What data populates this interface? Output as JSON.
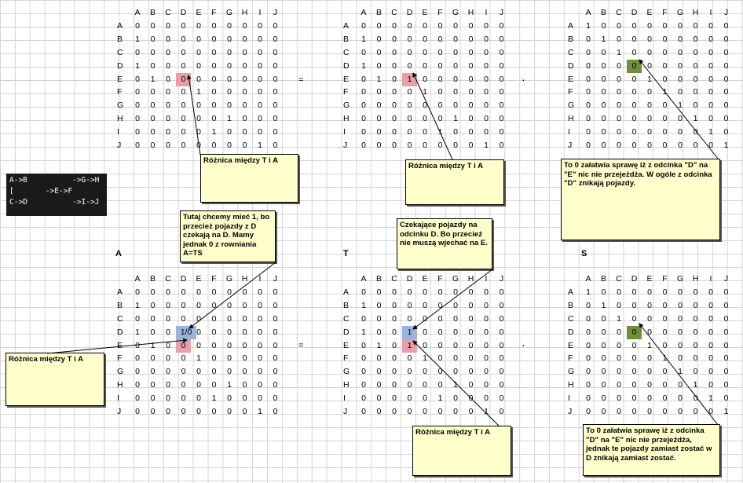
{
  "columns": [
    "A",
    "B",
    "C",
    "D",
    "E",
    "F",
    "G",
    "H",
    "I",
    "J"
  ],
  "matrices": [
    {
      "id": "m1",
      "label": "",
      "rows": [
        [
          "A",
          "0",
          "0",
          "0",
          "0",
          "0",
          "0",
          "0",
          "0",
          "0",
          "0"
        ],
        [
          "B",
          "1",
          "0",
          "0",
          "0",
          "0",
          "0",
          "0",
          "0",
          "0",
          "0"
        ],
        [
          "C",
          "0",
          "0",
          "0",
          "0",
          "0",
          "0",
          "0",
          "0",
          "0",
          "0"
        ],
        [
          "D",
          "1",
          "0",
          "0",
          "0",
          "0",
          "0",
          "0",
          "0",
          "0",
          "0"
        ],
        [
          "E",
          "0",
          "1",
          "0",
          "0",
          "0",
          "0",
          "0",
          "0",
          "0",
          "0"
        ],
        [
          "F",
          "0",
          "0",
          "0",
          "0",
          "1",
          "0",
          "0",
          "0",
          "0",
          "0"
        ],
        [
          "G",
          "0",
          "0",
          "0",
          "0",
          "0",
          "0",
          "0",
          "0",
          "0",
          "0"
        ],
        [
          "H",
          "0",
          "0",
          "0",
          "0",
          "0",
          "0",
          "1",
          "0",
          "0",
          "0"
        ],
        [
          "I",
          "0",
          "0",
          "0",
          "0",
          "0",
          "1",
          "0",
          "0",
          "0",
          "0"
        ],
        [
          "J",
          "0",
          "0",
          "0",
          "0",
          "0",
          "0",
          "0",
          "0",
          "1",
          "0"
        ]
      ],
      "highlights": [
        {
          "row": 4,
          "col": 3,
          "color": "pink"
        }
      ]
    },
    {
      "id": "m2",
      "label": "",
      "rows": [
        [
          "A",
          "0",
          "0",
          "0",
          "0",
          "0",
          "0",
          "0",
          "0",
          "0",
          "0"
        ],
        [
          "B",
          "1",
          "0",
          "0",
          "0",
          "0",
          "0",
          "0",
          "0",
          "0",
          "0"
        ],
        [
          "C",
          "0",
          "0",
          "0",
          "0",
          "0",
          "0",
          "0",
          "0",
          "0",
          "0"
        ],
        [
          "D",
          "1",
          "0",
          "0",
          "0",
          "0",
          "0",
          "0",
          "0",
          "0",
          "0"
        ],
        [
          "E",
          "0",
          "1",
          "0",
          "1",
          "0",
          "0",
          "0",
          "0",
          "0",
          "0"
        ],
        [
          "F",
          "0",
          "0",
          "0",
          "0",
          "1",
          "0",
          "0",
          "0",
          "0",
          "0"
        ],
        [
          "G",
          "0",
          "0",
          "0",
          "0",
          "0",
          "0",
          "0",
          "0",
          "0",
          "0"
        ],
        [
          "H",
          "0",
          "0",
          "0",
          "0",
          "0",
          "0",
          "1",
          "0",
          "0",
          "0"
        ],
        [
          "I",
          "0",
          "0",
          "0",
          "0",
          "0",
          "1",
          "0",
          "0",
          "0",
          "0"
        ],
        [
          "J",
          "0",
          "0",
          "0",
          "0",
          "0",
          "0",
          "0",
          "0",
          "1",
          "0"
        ]
      ],
      "highlights": [
        {
          "row": 4,
          "col": 3,
          "color": "pink"
        }
      ]
    },
    {
      "id": "m3",
      "label": "",
      "rows": [
        [
          "A",
          "1",
          "0",
          "0",
          "0",
          "0",
          "0",
          "0",
          "0",
          "0",
          "0"
        ],
        [
          "B",
          "0",
          "1",
          "0",
          "0",
          "0",
          "0",
          "0",
          "0",
          "0",
          "0"
        ],
        [
          "C",
          "0",
          "0",
          "1",
          "0",
          "0",
          "0",
          "0",
          "0",
          "0",
          "0"
        ],
        [
          "D",
          "0",
          "0",
          "0",
          "0",
          "0",
          "0",
          "0",
          "0",
          "0",
          "0"
        ],
        [
          "E",
          "0",
          "0",
          "0",
          "0",
          "1",
          "0",
          "0",
          "0",
          "0",
          "0"
        ],
        [
          "F",
          "0",
          "0",
          "0",
          "0",
          "0",
          "1",
          "0",
          "0",
          "0",
          "0"
        ],
        [
          "G",
          "0",
          "0",
          "0",
          "0",
          "0",
          "0",
          "1",
          "0",
          "0",
          "0"
        ],
        [
          "H",
          "0",
          "0",
          "0",
          "0",
          "0",
          "0",
          "0",
          "1",
          "0",
          "0"
        ],
        [
          "I",
          "0",
          "0",
          "0",
          "0",
          "0",
          "0",
          "0",
          "0",
          "1",
          "0"
        ],
        [
          "J",
          "0",
          "0",
          "0",
          "0",
          "0",
          "0",
          "0",
          "0",
          "0",
          "1"
        ]
      ],
      "highlights": [
        {
          "row": 3,
          "col": 3,
          "color": "green"
        }
      ]
    },
    {
      "id": "m4",
      "label": "A",
      "rows": [
        [
          "A",
          "0",
          "0",
          "0",
          "0",
          "0",
          "0",
          "0",
          "0",
          "0",
          "0"
        ],
        [
          "B",
          "1",
          "0",
          "0",
          "0",
          "0",
          "0",
          "0",
          "0",
          "0",
          "0"
        ],
        [
          "C",
          "0",
          "0",
          "0",
          "0",
          "0",
          "0",
          "0",
          "0",
          "0",
          "0"
        ],
        [
          "D",
          "1",
          "0",
          "0",
          "1/0",
          "0",
          "0",
          "0",
          "0",
          "0",
          "0"
        ],
        [
          "E",
          "0",
          "1",
          "0",
          "0",
          "0",
          "0",
          "0",
          "0",
          "0",
          "0"
        ],
        [
          "F",
          "0",
          "0",
          "0",
          "0",
          "1",
          "0",
          "0",
          "0",
          "0",
          "0"
        ],
        [
          "G",
          "0",
          "0",
          "0",
          "0",
          "0",
          "0",
          "0",
          "0",
          "0",
          "0"
        ],
        [
          "H",
          "0",
          "0",
          "0",
          "0",
          "0",
          "0",
          "1",
          "0",
          "0",
          "0"
        ],
        [
          "I",
          "0",
          "0",
          "0",
          "0",
          "0",
          "1",
          "0",
          "0",
          "0",
          "0"
        ],
        [
          "J",
          "0",
          "0",
          "0",
          "0",
          "0",
          "0",
          "0",
          "0",
          "1",
          "0"
        ]
      ],
      "highlights": [
        {
          "row": 3,
          "col": 3,
          "color": "blue"
        },
        {
          "row": 4,
          "col": 3,
          "color": "pink"
        }
      ]
    },
    {
      "id": "m5",
      "label": "T",
      "rows": [
        [
          "A",
          "0",
          "0",
          "0",
          "0",
          "0",
          "0",
          "0",
          "0",
          "0",
          "0"
        ],
        [
          "B",
          "1",
          "0",
          "0",
          "0",
          "0",
          "0",
          "0",
          "0",
          "0",
          "0"
        ],
        [
          "C",
          "0",
          "0",
          "0",
          "0",
          "0",
          "0",
          "0",
          "0",
          "0",
          "0"
        ],
        [
          "D",
          "1",
          "0",
          "0",
          "1",
          "0",
          "0",
          "0",
          "0",
          "0",
          "0"
        ],
        [
          "E",
          "0",
          "1",
          "0",
          "1",
          "0",
          "0",
          "0",
          "0",
          "0",
          "0"
        ],
        [
          "F",
          "0",
          "0",
          "0",
          "0",
          "1",
          "0",
          "0",
          "0",
          "0",
          "0"
        ],
        [
          "G",
          "0",
          "0",
          "0",
          "0",
          "0",
          "0",
          "0",
          "0",
          "0",
          "0"
        ],
        [
          "H",
          "0",
          "0",
          "0",
          "0",
          "0",
          "0",
          "1",
          "0",
          "0",
          "0"
        ],
        [
          "I",
          "0",
          "0",
          "0",
          "0",
          "0",
          "1",
          "0",
          "0",
          "0",
          "0"
        ],
        [
          "J",
          "0",
          "0",
          "0",
          "0",
          "0",
          "0",
          "0",
          "0",
          "1",
          "0"
        ]
      ],
      "highlights": [
        {
          "row": 3,
          "col": 3,
          "color": "blue"
        },
        {
          "row": 4,
          "col": 3,
          "color": "pink"
        }
      ]
    },
    {
      "id": "m6",
      "label": "S",
      "rows": [
        [
          "A",
          "1",
          "0",
          "0",
          "0",
          "0",
          "0",
          "0",
          "0",
          "0",
          "0"
        ],
        [
          "B",
          "0",
          "1",
          "0",
          "0",
          "0",
          "0",
          "0",
          "0",
          "0",
          "0"
        ],
        [
          "C",
          "0",
          "0",
          "1",
          "0",
          "0",
          "0",
          "0",
          "0",
          "0",
          "0"
        ],
        [
          "D",
          "0",
          "0",
          "0",
          "0",
          "0",
          "0",
          "0",
          "0",
          "0",
          "0"
        ],
        [
          "E",
          "0",
          "0",
          "0",
          "0",
          "1",
          "0",
          "0",
          "0",
          "0",
          "0"
        ],
        [
          "F",
          "0",
          "0",
          "0",
          "0",
          "0",
          "1",
          "0",
          "0",
          "0",
          "0"
        ],
        [
          "G",
          "0",
          "0",
          "0",
          "0",
          "0",
          "0",
          "1",
          "0",
          "0",
          "0"
        ],
        [
          "H",
          "0",
          "0",
          "0",
          "0",
          "0",
          "0",
          "0",
          "1",
          "0",
          "0"
        ],
        [
          "I",
          "0",
          "0",
          "0",
          "0",
          "0",
          "0",
          "0",
          "0",
          "1",
          "0"
        ],
        [
          "J",
          "0",
          "0",
          "0",
          "0",
          "0",
          "0",
          "0",
          "0",
          "0",
          "1"
        ]
      ],
      "highlights": [
        {
          "row": 3,
          "col": 3,
          "color": "green"
        }
      ]
    }
  ],
  "operators": [
    "=",
    "·",
    "=",
    "·"
  ],
  "sequence_lines": [
    "A->B          ->G->H",
    "[       ->E->F",
    "C->D          ->I->J"
  ],
  "notes": {
    "diff1": "Różnica między T i A",
    "diff2": "Różnica między T i A",
    "diff3": "Różnica między T i A",
    "diff4": "Różnica między T i A",
    "note_s1": "To 0 załatwia sprawę iż z odcinka \"D\" na \"E\" nic nie przejeżdża. W ogóle z odcinka \"D\" znikają pojazdy.",
    "note_a": "Tutaj chcemy mieć 1, bo przecież pojazdy z D czekają na D. Mamy jednak 0 z rowniania A=TS",
    "note_t": "Czekające pojazdy na odcinku D. Bo przecież nie muszą wjechać na E.",
    "note_s2": "To 0 załatwia sprawę iż z odcinka \"D\" na \"E\" nic nie przejeżdża, jednak te pojazdy zamiast zostać w D znikają zamiast zostać."
  },
  "colors": {
    "pink": "#e6a0a8",
    "blue": "#9bb4dc",
    "green": "#6e8f3e"
  }
}
